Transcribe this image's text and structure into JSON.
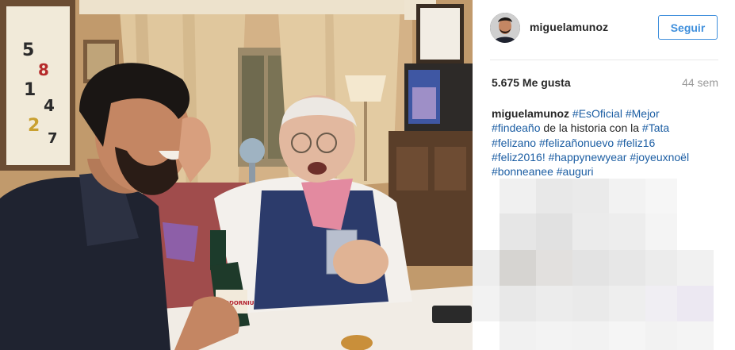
{
  "post": {
    "username": "miguelamunoz",
    "follow_label": "Seguir",
    "likes": "5.675 Me gusta",
    "time_ago": "44 sem",
    "caption": {
      "author": "miguelamunoz",
      "segments": [
        {
          "type": "tag",
          "text": "#EsOficial"
        },
        {
          "type": "text",
          "text": " "
        },
        {
          "type": "tag",
          "text": "#Mejor"
        },
        {
          "type": "text",
          "text": " "
        },
        {
          "type": "tag",
          "text": "#findeaño"
        },
        {
          "type": "text",
          "text": " de la historia con la "
        },
        {
          "type": "tag",
          "text": "#Tata"
        },
        {
          "type": "text",
          "text": " "
        },
        {
          "type": "tag",
          "text": "#felizano"
        },
        {
          "type": "text",
          "text": " "
        },
        {
          "type": "tag",
          "text": "#felizañonuevo"
        },
        {
          "type": "text",
          "text": " "
        },
        {
          "type": "tag",
          "text": "#feliz16"
        },
        {
          "type": "text",
          "text": " "
        },
        {
          "type": "tag",
          "text": "#feliz2016!"
        },
        {
          "type": "text",
          "text": " "
        },
        {
          "type": "tag",
          "text": "#happynewyear"
        },
        {
          "type": "text",
          "text": " "
        },
        {
          "type": "tag",
          "text": "#joyeuxnoël"
        },
        {
          "type": "text",
          "text": " "
        },
        {
          "type": "tag",
          "text": "#bonneanee"
        },
        {
          "type": "text",
          "text": " "
        },
        {
          "type": "tag",
          "text": "#auguri"
        }
      ]
    }
  },
  "photo": {
    "bottle_label": "CODORNIU"
  },
  "colors": {
    "link": "#1c5ea3",
    "follow_blue": "#3f8fdc",
    "muted": "#999999",
    "text": "#262626"
  }
}
